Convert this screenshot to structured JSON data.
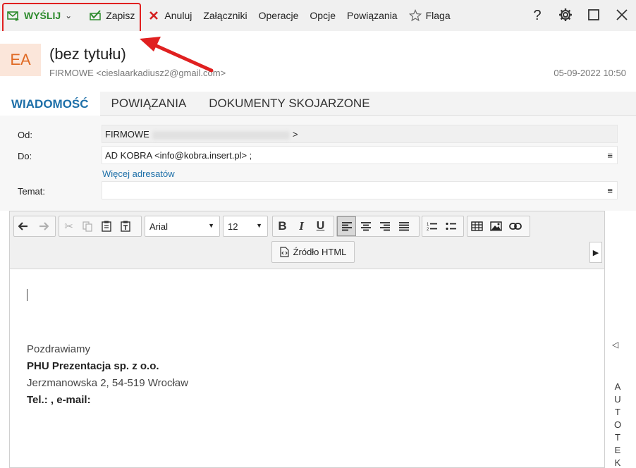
{
  "toolbar": {
    "send_label": "WYŚLIJ",
    "save_label": "Zapisz",
    "cancel_label": "Anuluj",
    "attachments_label": "Załączniki",
    "operations_label": "Operacje",
    "options_label": "Opcje",
    "relations_label": "Powiązania",
    "flag_label": "Flaga",
    "help_label": "?"
  },
  "header": {
    "avatar_initials": "EA",
    "subject": "(bez tytułu)",
    "sender": "FIRMOWE <cieslaarkadiusz2@gmail.com>",
    "datetime": "05-09-2022 10:50"
  },
  "tabs": [
    {
      "label": "WIADOMOŚĆ",
      "active": true
    },
    {
      "label": "POWIĄZANIA",
      "active": false
    },
    {
      "label": "DOKUMENTY SKOJARZONE",
      "active": false
    }
  ],
  "form": {
    "from_label": "Od:",
    "from_value_prefix": "FIRMOWE",
    "from_value_suffix": ">",
    "to_label": "Do:",
    "to_value": "AD KOBRA <info@kobra.insert.pl> ;",
    "more_recipients": "Więcej adresatów",
    "subject_label": "Temat:",
    "subject_value": ""
  },
  "editor": {
    "font_family": "Arial",
    "font_size": "12",
    "html_source_label": "Źródło HTML",
    "signature": {
      "greeting": "Pozdrawiamy",
      "company": "PHU Prezentacja sp. z o.o.",
      "address": "Jerzmanowska 2, 54-519 Wrocław",
      "contact_label": "Tel.: , e-mail:"
    }
  },
  "side_panel": {
    "collapse_glyph": "◁",
    "vertical_text": "AUTOTEK"
  },
  "colors": {
    "send_green": "#2c8a2c",
    "tab_active_blue": "#1d6fa8",
    "avatar_orange": "#e06a24",
    "annotation_red": "#e02020"
  }
}
